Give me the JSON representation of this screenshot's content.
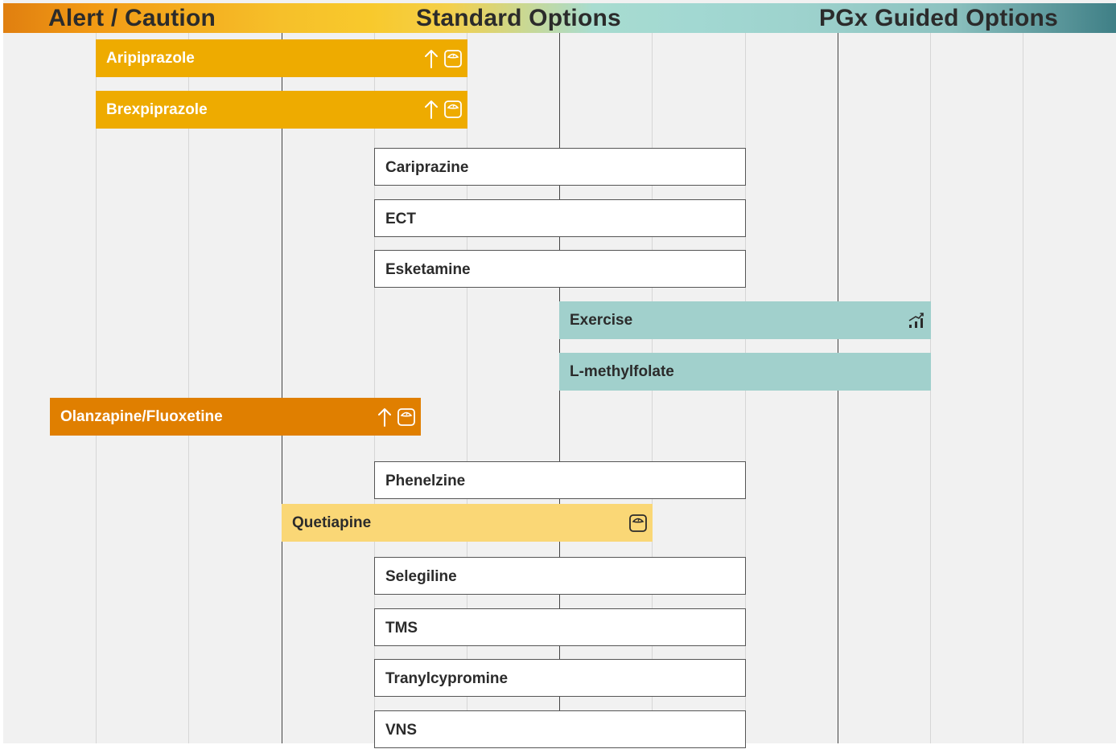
{
  "header": {
    "alert_label": "Alert / Caution",
    "standard_label": "Standard Options",
    "pgx_label": "PGx Guided Options"
  },
  "colors": {
    "alert_strong": "#e07f00",
    "alert": "#eeab00",
    "caution_light": "#fad776",
    "standard": "#ffffff",
    "pgx": "#a1d0cc",
    "gridline_minor": "#d6d6d6",
    "gridline_major": "#444444"
  },
  "chart_data": {
    "type": "bar",
    "orientation": "horizontal",
    "title": "",
    "xlim": [
      0,
      12
    ],
    "major_gridlines": [
      3,
      6,
      9
    ],
    "grid": true,
    "categories": [
      "Aripiprazole",
      "Brexpiprazole",
      "Cariprazine",
      "ECT",
      "Esketamine",
      "Exercise",
      "L-methylfolate",
      "Olanzapine/Fluoxetine",
      "Phenelzine",
      "Quetiapine",
      "Selegiline",
      "TMS",
      "Tranylcypromine",
      "VNS"
    ],
    "series": [
      {
        "items": [
          {
            "label": "Aripiprazole",
            "start": 1,
            "end": 5,
            "category": "alert",
            "icons": [
              "arrow-up-icon",
              "weight-scale-icon"
            ]
          },
          {
            "label": "Brexpiprazole",
            "start": 1,
            "end": 5,
            "category": "alert",
            "icons": [
              "arrow-up-icon",
              "weight-scale-icon"
            ]
          },
          {
            "label": "Cariprazine",
            "start": 4,
            "end": 8,
            "category": "standard",
            "icons": []
          },
          {
            "label": "ECT",
            "start": 4,
            "end": 8,
            "category": "standard",
            "icons": []
          },
          {
            "label": "Esketamine",
            "start": 4,
            "end": 8,
            "category": "standard",
            "icons": []
          },
          {
            "label": "Exercise",
            "start": 6,
            "end": 10,
            "category": "pgx",
            "icons": [
              "trend-chart-icon"
            ]
          },
          {
            "label": "L-methylfolate",
            "start": 6,
            "end": 10,
            "category": "pgx",
            "icons": []
          },
          {
            "label": "Olanzapine/Fluoxetine",
            "start": 0.5,
            "end": 4.5,
            "category": "alert_strong",
            "icons": [
              "arrow-up-icon",
              "weight-scale-icon"
            ]
          },
          {
            "label": "Phenelzine",
            "start": 4,
            "end": 8,
            "category": "standard",
            "icons": []
          },
          {
            "label": "Quetiapine",
            "start": 3,
            "end": 7,
            "category": "caution_light",
            "icons": [
              "weight-scale-icon"
            ]
          },
          {
            "label": "Selegiline",
            "start": 4,
            "end": 8,
            "category": "standard",
            "icons": []
          },
          {
            "label": "TMS",
            "start": 4,
            "end": 8,
            "category": "standard",
            "icons": []
          },
          {
            "label": "Tranylcypromine",
            "start": 4,
            "end": 8,
            "category": "standard",
            "icons": []
          },
          {
            "label": "VNS",
            "start": 4,
            "end": 8,
            "category": "standard",
            "icons": []
          }
        ]
      }
    ]
  }
}
